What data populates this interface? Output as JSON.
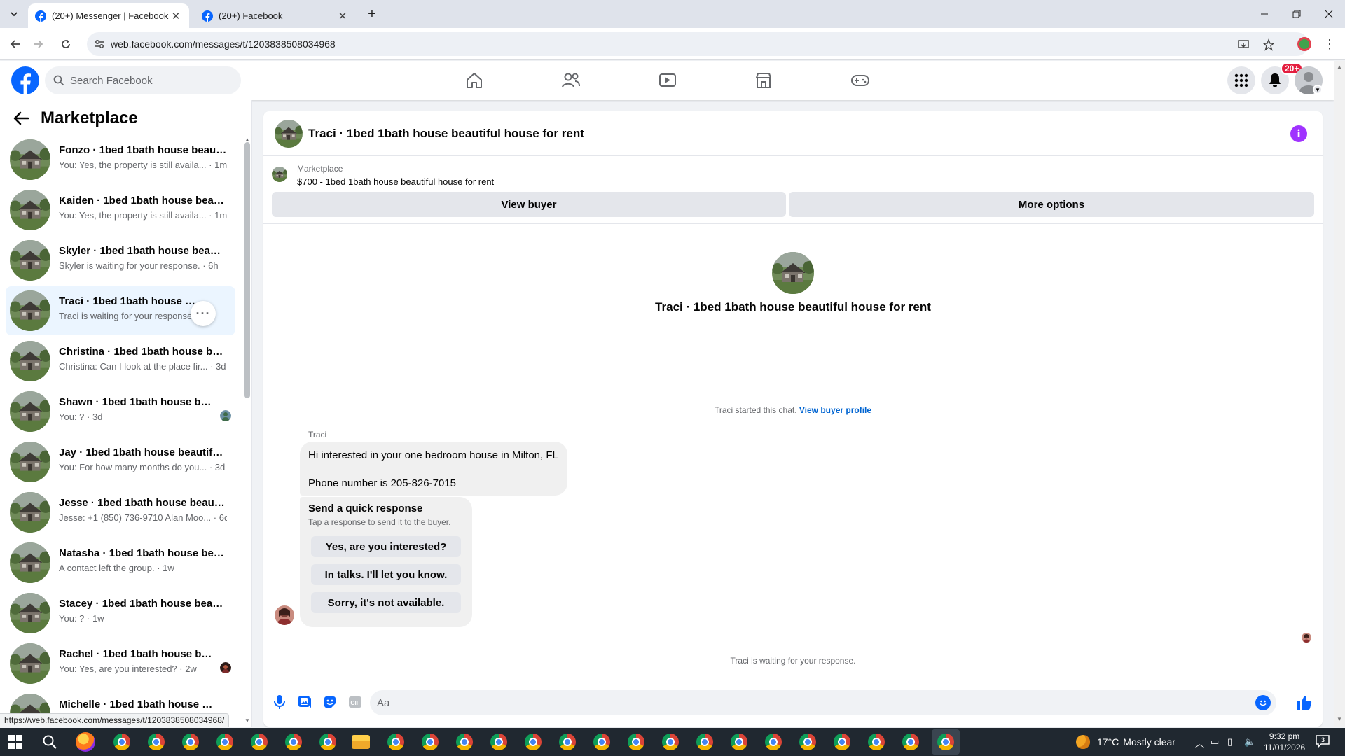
{
  "browser": {
    "tabs": [
      {
        "label": "(20+) Messenger | Facebook",
        "active": true
      },
      {
        "label": "(20+) Facebook",
        "active": false
      }
    ],
    "url": "web.facebook.com/messages/t/1203838508034968",
    "status_url": "https://web.facebook.com/messages/t/1203838508034968/"
  },
  "header": {
    "search_placeholder": "Search Facebook",
    "notification_badge": "20+"
  },
  "sidebar": {
    "title": "Marketplace",
    "conversations": [
      {
        "name": "Fonzo · 1bed 1bath house beautiful house for rent",
        "preview": "You: Yes, the property is still availa... · 1m"
      },
      {
        "name": "Kaiden · 1bed 1bath house beautiful house for rent",
        "preview": "You: Yes, the property is still availa... · 1m"
      },
      {
        "name": "Skyler · 1bed 1bath house beautiful house for rent",
        "preview": "Skyler is waiting for your response. · 6h"
      },
      {
        "name": "Traci · 1bed 1bath house beautiful house for rent",
        "preview": "Traci is waiting for your response.",
        "selected": true
      },
      {
        "name": "Christina · 1bed 1bath house beautiful house for rent",
        "preview": "Christina: Can I look at the place fir... · 3d"
      },
      {
        "name": "Shawn · 1bed 1bath house beautiful house for rent",
        "preview": "You: ? · 3d"
      },
      {
        "name": "Jay · 1bed 1bath house beautiful house for rent",
        "preview": "You: For how many months do you... · 3d"
      },
      {
        "name": "Jesse · 1bed 1bath house beautiful house for rent",
        "preview": "Jesse: +1 (850) 736-9710 Alan Moo... · 6d"
      },
      {
        "name": "Natasha · 1bed 1bath house beautiful house for rent",
        "preview": "A contact left the group. · 1w"
      },
      {
        "name": "Stacey · 1bed 1bath house beautiful house for rent",
        "preview": "You: ? · 1w"
      },
      {
        "name": "Rachel · 1bed 1bath house beautiful house for rent",
        "preview": "You: Yes, are you interested? · 2w"
      },
      {
        "name": "Michelle · 1bed 1bath house beautiful house for rent",
        "preview": ""
      }
    ]
  },
  "chat": {
    "title": "Traci · 1bed 1bath house beautiful house for rent",
    "marketplace_label": "Marketplace",
    "listing": "$700 - 1bed 1bath house beautiful house for rent",
    "view_buyer": "View buyer",
    "more_options": "More options",
    "center_name": "Traci · 1bed 1bath house beautiful house for rent",
    "started_text": "Traci started this chat.",
    "view_buyer_profile": "View buyer profile",
    "sender": "Traci",
    "message_line1": "Hi interested in your one bedroom house in Milton, FL",
    "message_line2": "Phone number is 205-826-7015",
    "quick_title": "Send a quick response",
    "quick_subtitle": "Tap a response to send it to the buyer.",
    "quick_responses": [
      "Yes, are you interested?",
      "In talks. I'll let you know.",
      "Sorry, it's not available."
    ],
    "waiting": "Traci is waiting for your response.",
    "composer_placeholder": "Aa"
  },
  "taskbar": {
    "temperature": "17°C",
    "weather": "Mostly clear",
    "time": "9:32 pm",
    "date": "11/01/2026",
    "notifications": "3"
  },
  "colors": {
    "accent": "#0866ff",
    "info": "#a033ff",
    "badge": "#e41e3f"
  }
}
